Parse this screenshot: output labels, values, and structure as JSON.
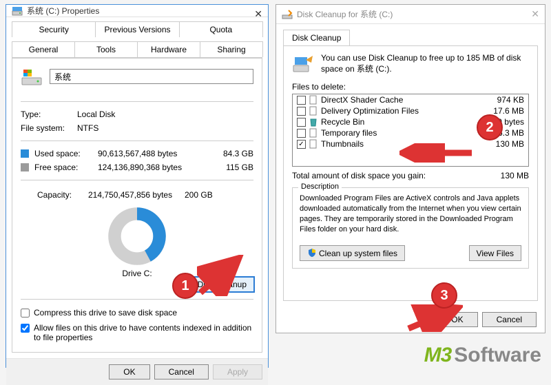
{
  "left": {
    "title": "系统 (C:) Properties",
    "tabs_upper": [
      "Security",
      "Previous Versions",
      "Quota"
    ],
    "tabs_lower": [
      "General",
      "Tools",
      "Hardware",
      "Sharing"
    ],
    "active_tab": "General",
    "drive_name": "系统",
    "type_label": "Type:",
    "type_value": "Local Disk",
    "fs_label": "File system:",
    "fs_value": "NTFS",
    "used_label": "Used space:",
    "used_bytes": "90,613,567,488 bytes",
    "used_hr": "84.3 GB",
    "used_color": "#2a8cd8",
    "free_label": "Free space:",
    "free_bytes": "124,136,890,368 bytes",
    "free_hr": "115 GB",
    "free_color": "#9b9b9b",
    "cap_label": "Capacity:",
    "cap_bytes": "214,750,457,856 bytes",
    "cap_hr": "200 GB",
    "donut_used_pct": 42,
    "drive_label_text": "Drive C:",
    "disk_cleanup_btn": "Disk Cleanup",
    "compress_label": "Compress this drive to save disk space",
    "compress_checked": false,
    "index_label": "Allow files on this drive to have contents indexed in addition to file properties",
    "index_checked": true,
    "ok": "OK",
    "cancel": "Cancel",
    "apply": "Apply"
  },
  "right": {
    "title": "Disk Cleanup for 系统 (C:)",
    "tab": "Disk Cleanup",
    "intro": "You can use Disk Cleanup to free up to 185 MB of disk space on 系统 (C:).",
    "files_to_delete_label": "Files to delete:",
    "files": [
      {
        "name": "DirectX Shader Cache",
        "size": "974 KB",
        "checked": false,
        "icon": "file"
      },
      {
        "name": "Delivery Optimization Files",
        "size": "17.6 MB",
        "checked": false,
        "icon": "file"
      },
      {
        "name": "Recycle Bin",
        "size": "0 bytes",
        "checked": false,
        "icon": "recycle"
      },
      {
        "name": "Temporary files",
        "size": "36.3 MB",
        "checked": false,
        "icon": "file"
      },
      {
        "name": "Thumbnails",
        "size": "130 MB",
        "checked": true,
        "icon": "file"
      }
    ],
    "total_label": "Total amount of disk space you gain:",
    "total_value": "130 MB",
    "desc_legend": "Description",
    "desc_text": "Downloaded Program Files are ActiveX controls and Java applets downloaded automatically from the Internet when you view certain pages. They are temporarily stored in the Downloaded Program Files folder on your hard disk.",
    "cleanup_sysfiles": "Clean up system files",
    "view_files": "View Files",
    "ok": "OK",
    "cancel": "Cancel"
  },
  "annotations": {
    "badge1": "1",
    "badge2": "2",
    "badge3": "3"
  },
  "watermark": {
    "m3": "M3",
    "sw": "Software"
  }
}
